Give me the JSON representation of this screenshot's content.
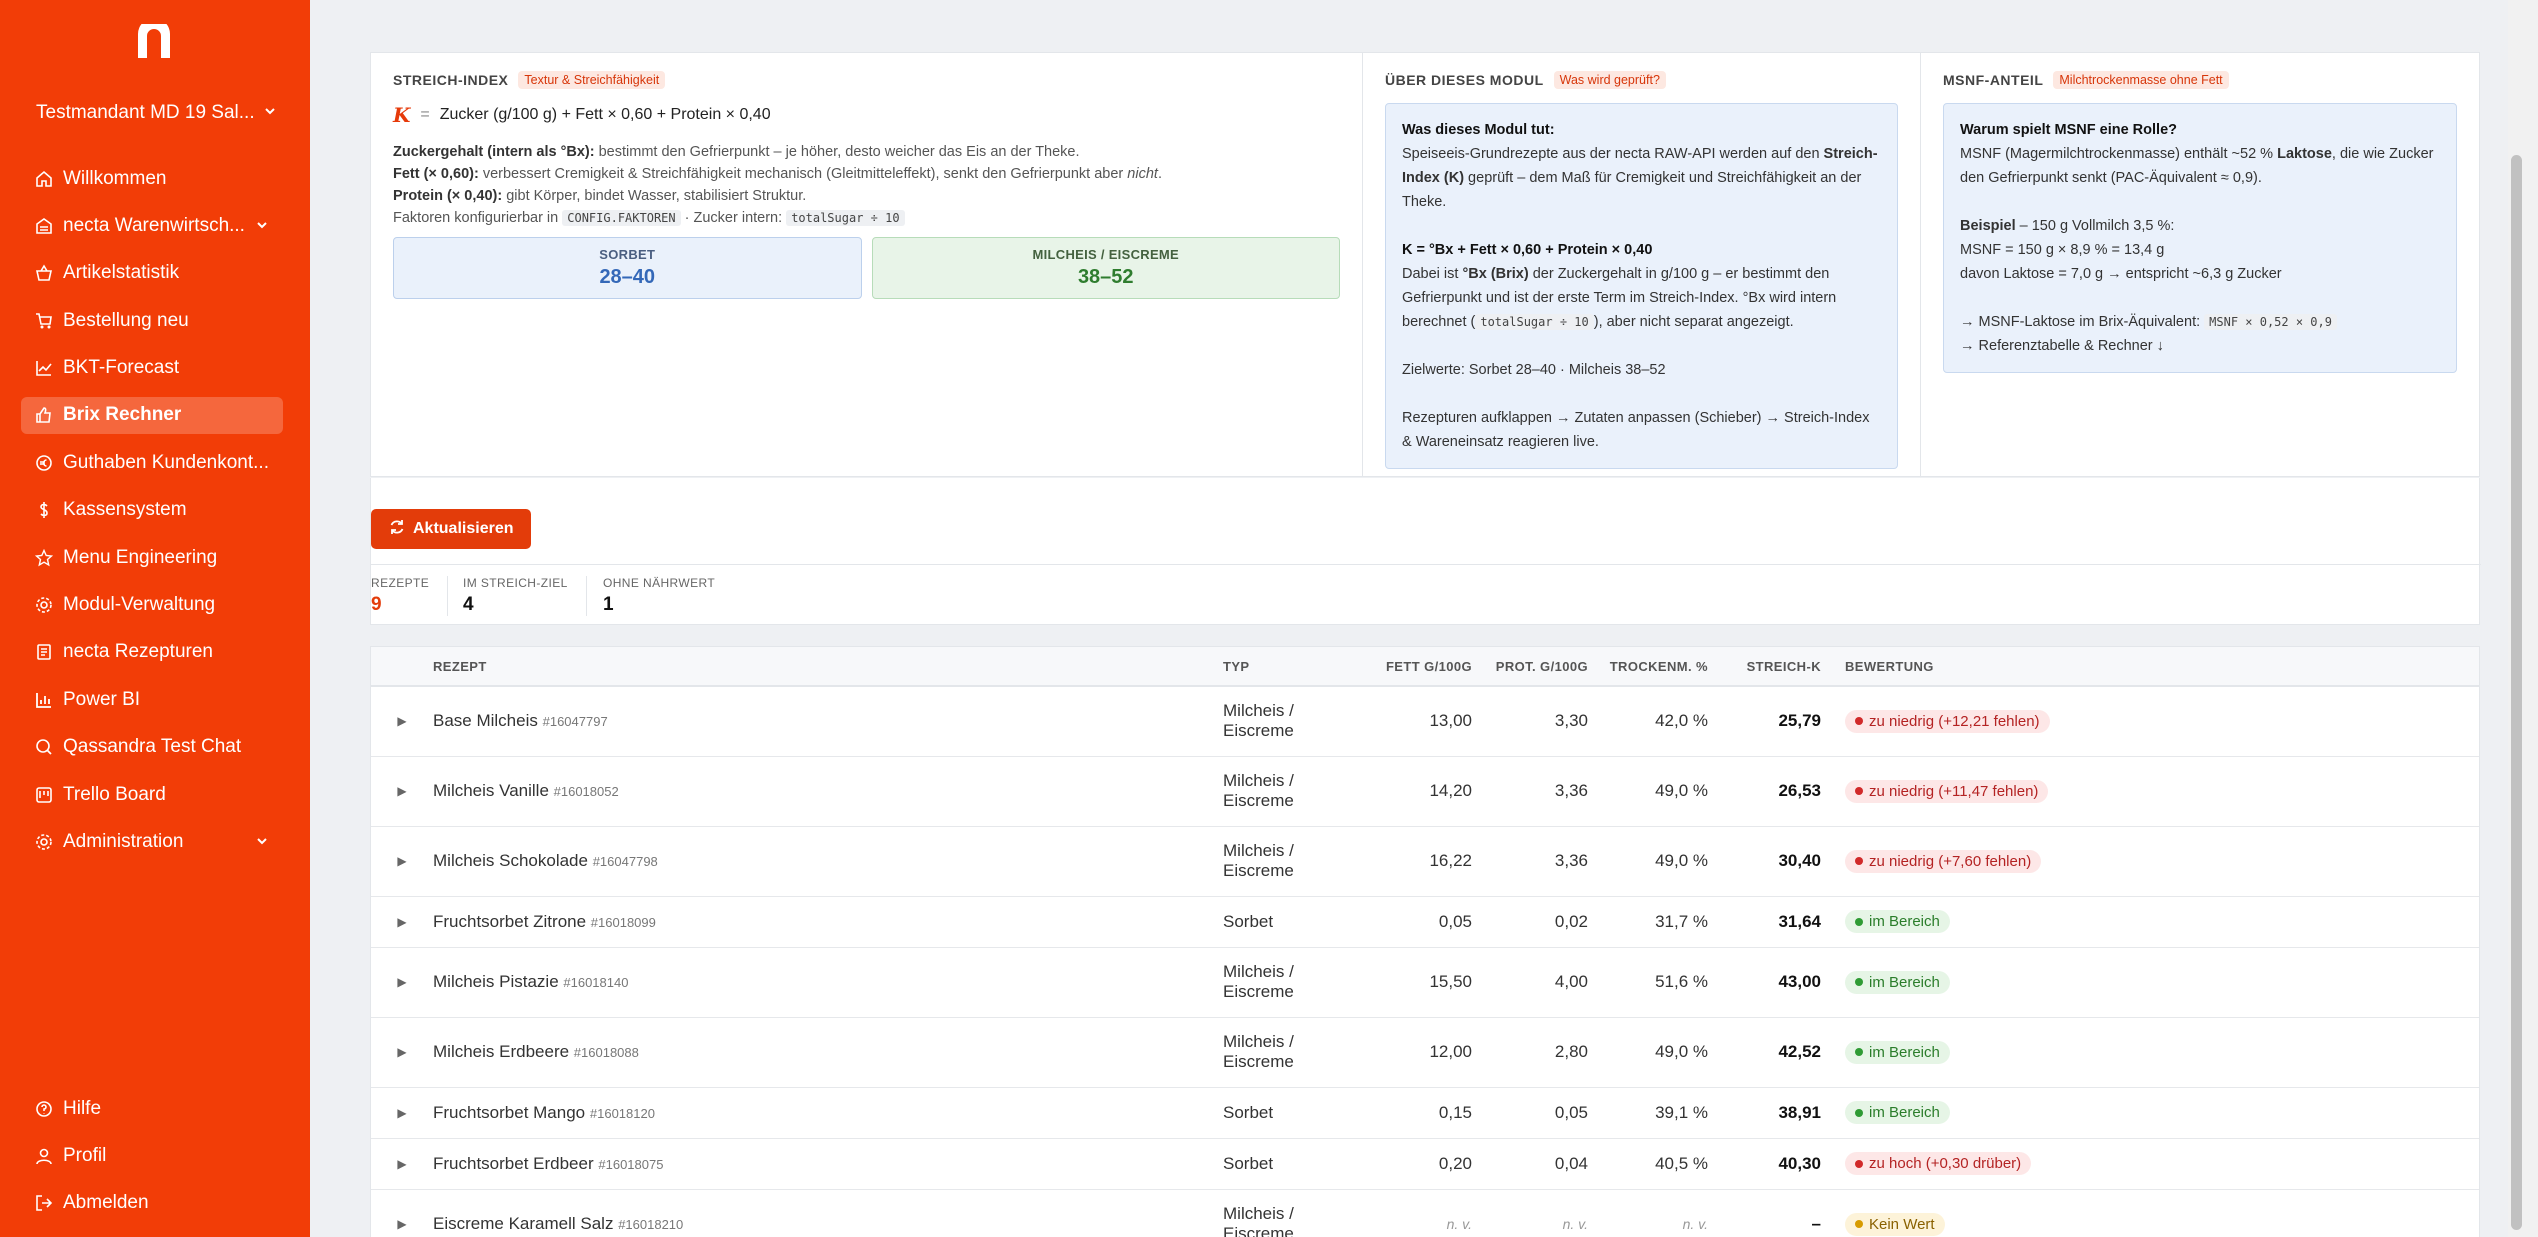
{
  "sidebar": {
    "tenant": "Testmandant MD 19 Sal...",
    "items": [
      {
        "label": "Willkommen",
        "icon": "home-icon"
      },
      {
        "label": "necta Warenwirtsch...",
        "icon": "warehouse-icon"
      },
      {
        "label": "Artikelstatistik",
        "icon": "basket-icon"
      },
      {
        "label": "Bestellung neu",
        "icon": "cart-icon"
      },
      {
        "label": "BKT-Forecast",
        "icon": "chart-line-icon"
      },
      {
        "label": "Brix Rechner",
        "icon": "thumbs-up-icon"
      },
      {
        "label": "Guthaben Kundenkont...",
        "icon": "euro-icon"
      },
      {
        "label": "Kassensystem",
        "icon": "dollar-icon"
      },
      {
        "label": "Menu Engineering",
        "icon": "star-icon"
      },
      {
        "label": "Modul-Verwaltung",
        "icon": "gear-icon"
      },
      {
        "label": "necta Rezepturen",
        "icon": "document-icon"
      },
      {
        "label": "Power BI",
        "icon": "bar-chart-icon"
      },
      {
        "label": "Qassandra Test Chat",
        "icon": "chat-icon"
      },
      {
        "label": "Trello Board",
        "icon": "board-icon"
      },
      {
        "label": "Administration",
        "icon": "admin-gear-icon"
      }
    ],
    "bottom": [
      {
        "label": "Hilfe",
        "icon": "help-icon"
      },
      {
        "label": "Profil",
        "icon": "user-icon"
      },
      {
        "label": "Abmelden",
        "icon": "logout-icon"
      }
    ]
  },
  "streich": {
    "title": "STREICH-INDEX",
    "tag": "Textur & Streichfähigkeit",
    "k": "K",
    "eq": "=",
    "formula": "Zucker (g/100 g) + Fett × 0,60 + Protein × 0,40",
    "l1_b": "Zuckergehalt (intern als °Bx):",
    "l1": " bestimmt den Gefrierpunkt – je höher, desto weicher das Eis an der Theke.",
    "l2_b": "Fett (× 0,60):",
    "l2": " verbessert Cremigkeit & Streichfähigkeit mechanisch (Gleitmitteleffekt), senkt den Gefrierpunkt aber ",
    "l2_i": "nicht",
    "l2_end": ".",
    "l3_b": "Protein (× 0,40):",
    "l3": " gibt Körper, bindet Wasser, stabilisiert Struktur.",
    "l4": "Faktoren konfigurierbar in ",
    "l4_code": "CONFIG.FAKTOREN",
    "l4_mid": " · Zucker intern: ",
    "l4_code2": "totalSugar ÷ 10",
    "sorbet_label": "SORBET",
    "sorbet_range": "28–40",
    "milch_label": "MILCHEIS / EISCREME",
    "milch_range": "38–52"
  },
  "modul": {
    "title": "ÜBER DIESES MODUL",
    "tag": "Was wird geprüft?",
    "h": "Was dieses Modul tut:",
    "p1": "Speiseeis-Grundrezepte aus der necta RAW-API werden auf den ",
    "p1_b": "Streich-Index (K)",
    "p1_end": " geprüft – dem Maß für Cremigkeit und Streichfähigkeit an der Theke.",
    "formula": "K = °Bx + Fett × 0,60 + Protein × 0,40",
    "p2": "Dabei ist ",
    "p2_b": "°Bx (Brix)",
    "p2_mid": " der Zuckergehalt in g/100 g – er bestimmt den Gefrierpunkt und ist der erste Term im Streich-Index. °Bx wird intern berechnet (",
    "p2_code": "totalSugar ÷ 10",
    "p2_end": "), aber nicht separat angezeigt.",
    "p3": "Zielwerte: Sorbet 28–40 · Milcheis 38–52",
    "p4": "Rezepturen aufklappen → Zutaten anpassen (Schieber) → Streich-Index & Wareneinsatz reagieren live."
  },
  "msnf": {
    "title": "MSNF-ANTEIL",
    "tag": "Milchtrockenmasse ohne Fett",
    "h": "Warum spielt MSNF eine Rolle?",
    "p1": "MSNF (Magermilchtrockenmasse) enthält ~52 % ",
    "p1_b": "Laktose",
    "p1_end": ", die wie Zucker den Gefrierpunkt senkt (PAC-Äquivalent ≈ 0,9).",
    "ex_b": "Beispiel",
    "ex": " – 150 g Vollmilch 3,5 %:",
    "ex2": "MSNF = 150 g × 8,9 % = 13,4 g",
    "ex3": "davon Laktose = 7,0 g → entspricht ~6,3 g Zucker",
    "l1": "→ MSNF-Laktose im Brix-Äquivalent: ",
    "l1_code": "MSNF × 0,52 × 0,9",
    "l2": "→ Referenztabelle & Rechner ↓"
  },
  "toolbar": {
    "refresh_label": "Aktualisieren",
    "stats": [
      {
        "label": "REZEPTE",
        "value": "9"
      },
      {
        "label": "IM STREICH-ZIEL",
        "value": "4"
      },
      {
        "label": "OHNE NÄHRWERT",
        "value": "1"
      }
    ]
  },
  "table": {
    "headers": [
      "REZEPT",
      "TYP",
      "FETT G/100G",
      "PROT. G/100G",
      "TROCKENM. %",
      "STREICH-K",
      "BEWERTUNG"
    ],
    "rows": [
      {
        "name": "Base Milcheis",
        "id": "#16047797",
        "type1": "Milcheis /",
        "type2": "Eiscreme",
        "fett": "13,00",
        "prot": "3,30",
        "trock": "42,0 %",
        "k": "25,79",
        "status": "zu niedrig (+12,21 fehlen)",
        "kind": "low"
      },
      {
        "name": "Milcheis Vanille",
        "id": "#16018052",
        "type1": "Milcheis /",
        "type2": "Eiscreme",
        "fett": "14,20",
        "prot": "3,36",
        "trock": "49,0 %",
        "k": "26,53",
        "status": "zu niedrig (+11,47 fehlen)",
        "kind": "low"
      },
      {
        "name": "Milcheis Schokolade",
        "id": "#16047798",
        "type1": "Milcheis /",
        "type2": "Eiscreme",
        "fett": "16,22",
        "prot": "3,36",
        "trock": "49,0 %",
        "k": "30,40",
        "status": "zu niedrig (+7,60 fehlen)",
        "kind": "low"
      },
      {
        "name": "Fruchtsorbet Zitrone",
        "id": "#16018099",
        "type1": "Sorbet",
        "type2": "",
        "fett": "0,05",
        "prot": "0,02",
        "trock": "31,7 %",
        "k": "31,64",
        "status": "im Bereich",
        "kind": "ok"
      },
      {
        "name": "Milcheis Pistazie",
        "id": "#16018140",
        "type1": "Milcheis /",
        "type2": "Eiscreme",
        "fett": "15,50",
        "prot": "4,00",
        "trock": "51,6 %",
        "k": "43,00",
        "status": "im Bereich",
        "kind": "ok"
      },
      {
        "name": "Milcheis Erdbeere",
        "id": "#16018088",
        "type1": "Milcheis /",
        "type2": "Eiscreme",
        "fett": "12,00",
        "prot": "2,80",
        "trock": "49,0 %",
        "k": "42,52",
        "status": "im Bereich",
        "kind": "ok"
      },
      {
        "name": "Fruchtsorbet Mango",
        "id": "#16018120",
        "type1": "Sorbet",
        "type2": "",
        "fett": "0,15",
        "prot": "0,05",
        "trock": "39,1 %",
        "k": "38,91",
        "status": "im Bereich",
        "kind": "ok"
      },
      {
        "name": "Fruchtsorbet Erdbeer",
        "id": "#16018075",
        "type1": "Sorbet",
        "type2": "",
        "fett": "0,20",
        "prot": "0,04",
        "trock": "40,5 %",
        "k": "40,30",
        "status": "zu hoch (+0,30 drüber)",
        "kind": "low"
      },
      {
        "name": "Eiscreme Karamell Salz",
        "id": "#16018210",
        "type1": "Milcheis /",
        "type2": "Eiscreme",
        "fett": "n. v.",
        "prot": "n. v.",
        "trock": "n. v.",
        "k": "–",
        "status": "Kein Wert",
        "kind": "na"
      }
    ]
  }
}
